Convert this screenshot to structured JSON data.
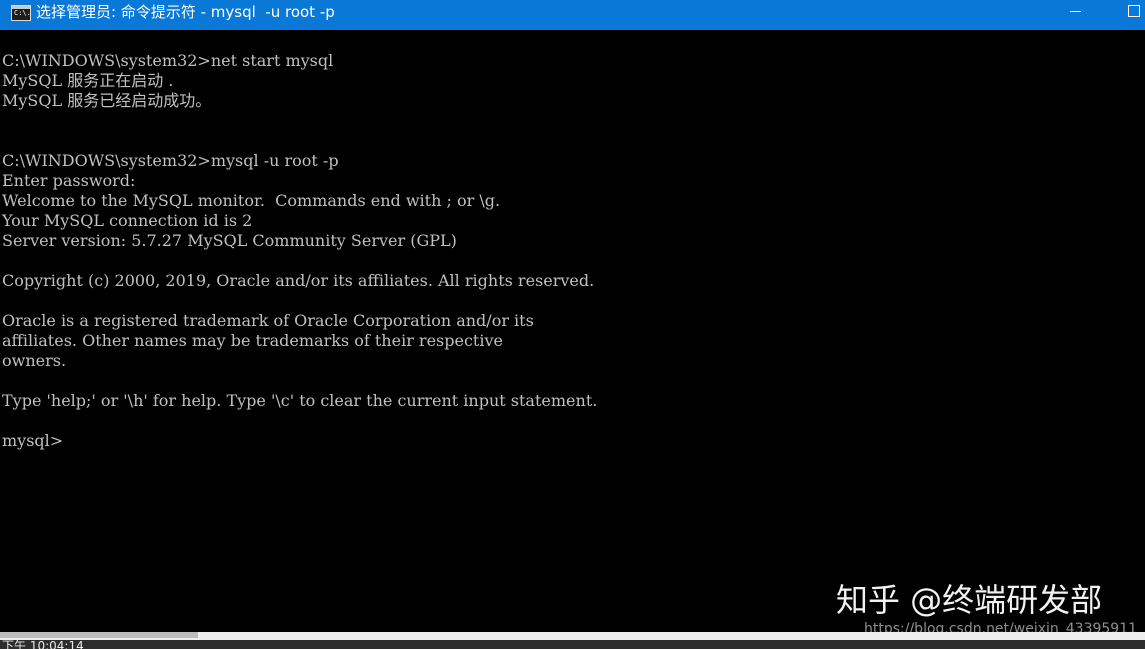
{
  "window": {
    "title": "选择管理员: 命令提示符 - mysql  -u root -p",
    "icon": "cmd-icon",
    "icon_label": "C:\\.",
    "titlebar_color": "#0a78d7"
  },
  "console": {
    "lines": [
      "C:\\WINDOWS\\system32>net start mysql",
      "MySQL 服务正在启动 .",
      "MySQL 服务已经启动成功。",
      "",
      "",
      "C:\\WINDOWS\\system32>mysql -u root -p",
      "Enter password:",
      "Welcome to the MySQL monitor.  Commands end with ; or \\g.",
      "Your MySQL connection id is 2",
      "Server version: 5.7.27 MySQL Community Server (GPL)",
      "",
      "Copyright (c) 2000, 2019, Oracle and/or its affiliates. All rights reserved.",
      "",
      "Oracle is a registered trademark of Oracle Corporation and/or its",
      "affiliates. Other names may be trademarks of their respective",
      "owners.",
      "",
      "Type 'help;' or '\\h' for help. Type '\\c' to clear the current input statement.",
      "",
      "mysql>"
    ],
    "text_color": "#c0c0c0",
    "background": "#000000"
  },
  "watermark": {
    "text": "知乎 @终端研发部",
    "url": "https://blog.csdn.net/weixin_43395911"
  },
  "taskbar": {
    "partial_text": "下午 10:04:14"
  }
}
